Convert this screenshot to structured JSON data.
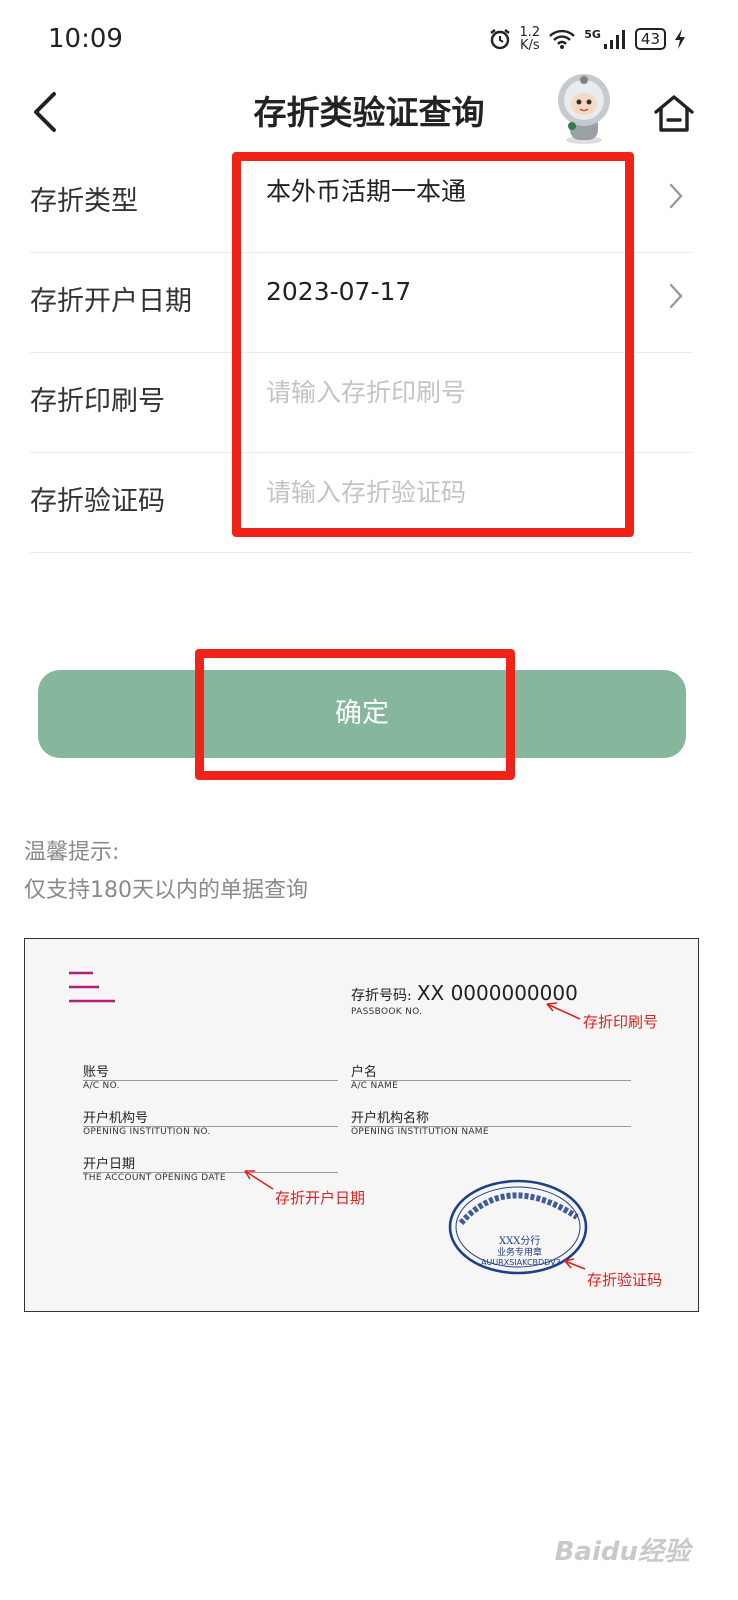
{
  "status_bar": {
    "time": "10:09",
    "net_speed_value": "1.2",
    "net_speed_unit": "K/s",
    "signal": "5G",
    "battery": "43",
    "icons": [
      "alarm-icon",
      "wifi-icon",
      "signal-icon",
      "battery-icon",
      "charging-icon"
    ]
  },
  "header": {
    "title": "存折类验证查询",
    "back_icon": "chevron-left-icon",
    "home_icon": "home-icon",
    "mascot": "mascot-avatar"
  },
  "form": {
    "rows": [
      {
        "label": "存折类型",
        "value": "本外币活期一本通",
        "chevron": true
      },
      {
        "label": "存折开户日期",
        "value": "2023-07-17",
        "chevron": true
      },
      {
        "label": "存折印刷号",
        "placeholder": "请输入存折印刷号",
        "value": ""
      },
      {
        "label": "存折验证码",
        "placeholder": "请输入存折验证码",
        "value": ""
      }
    ]
  },
  "confirm_button": {
    "label": "确定",
    "color": "#86b79c"
  },
  "tips": {
    "title": "温馨提示:",
    "lines": [
      "仅支持180天以内的单据查询"
    ]
  },
  "passbook_sample": {
    "number_label_cn": "存折号码:",
    "number_value": "XX 0000000000",
    "number_label_en": "PASSBOOK NO.",
    "fields": [
      {
        "cn": "账号",
        "en": "A/C NO."
      },
      {
        "cn": "户名",
        "en": "A/C NAME"
      },
      {
        "cn": "开户机构号",
        "en": "OPENING INSTITUTION NO."
      },
      {
        "cn": "开户机构名称",
        "en": "OPENING INSTITUTION NAME"
      },
      {
        "cn": "开户日期",
        "en": "THE ACCOUNT OPENING DATE"
      }
    ],
    "annotations": {
      "print_no": "存折印刷号",
      "open_date": "存折开户日期",
      "verify_code": "存折验证码"
    },
    "stamp": {
      "line1": "XXX分行",
      "line2": "业务专用章",
      "code": "AUURXSIAKCBDDV3"
    }
  },
  "watermark": "Baidu经验",
  "colors": {
    "accent_green": "#86b79c",
    "highlight_red": "#f02318",
    "annotation_red": "#e02020"
  }
}
